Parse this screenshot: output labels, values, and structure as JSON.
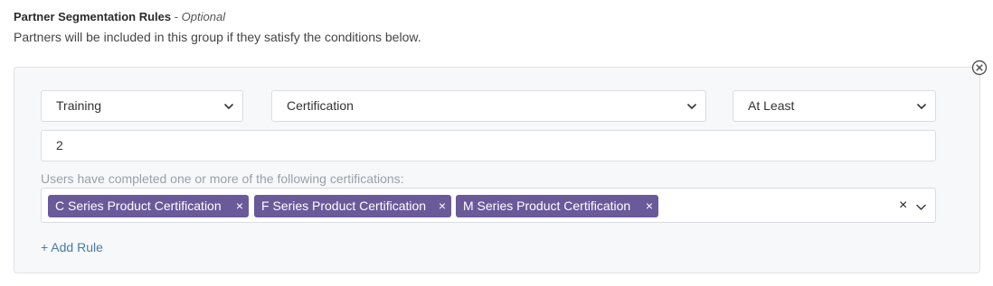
{
  "header": {
    "title": "Partner Segmentation Rules",
    "separator": " - ",
    "optional_label": "Optional",
    "description": "Partners will be included in this group if they satisfy the conditions below."
  },
  "rule": {
    "category_select": {
      "value": "Training"
    },
    "type_select": {
      "value": "Certification"
    },
    "operator_select": {
      "value": "At Least"
    },
    "count_input": {
      "value": "2"
    },
    "help_text": "Users have completed one or more of the following certifications:",
    "selected_items": [
      {
        "label": "C Series Product Certification",
        "remove": "×"
      },
      {
        "label": "F Series Product Certification",
        "remove": "×"
      },
      {
        "label": "M Series Product Certification",
        "remove": "×"
      }
    ],
    "clear_all": "×"
  },
  "add_rule_label": "+ Add Rule",
  "colors": {
    "chip_bg": "#6a5a9a",
    "link": "#4a7aa5",
    "panel_bg": "#f7f8fa"
  }
}
